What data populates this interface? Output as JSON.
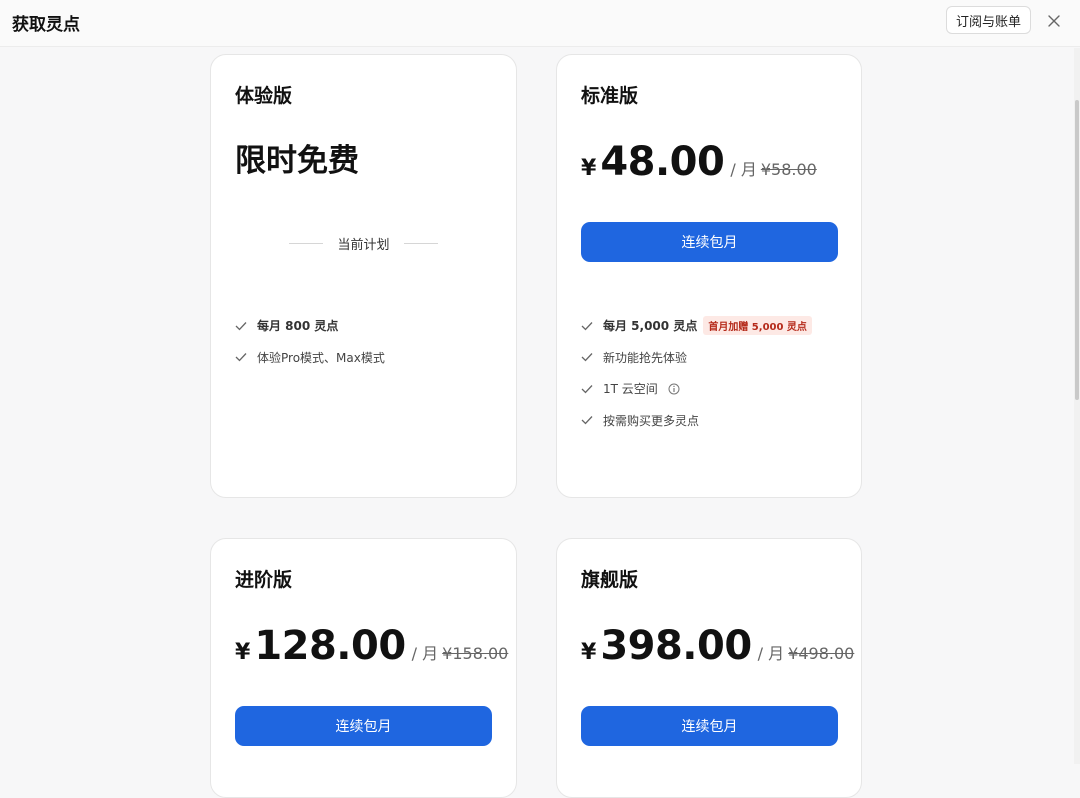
{
  "header": {
    "title": "获取灵点",
    "billing_label": "订阅与账单",
    "close_icon": "close-icon"
  },
  "plans": [
    {
      "name": "体验版",
      "price_text": "限时免费",
      "current_label": "当前计划",
      "features": [
        {
          "text": "每月 800 灵点",
          "bold": true
        },
        {
          "text": "体验Pro模式、Max模式"
        }
      ]
    },
    {
      "name": "标准版",
      "currency": "¥",
      "price": "48.00",
      "period": "/ 月",
      "original_price": "¥58.00",
      "button_label": "连续包月",
      "features": [
        {
          "text": "每月 5,000 灵点",
          "bold": true,
          "badge": "首月加赠 5,000 灵点"
        },
        {
          "text": "新功能抢先体验"
        },
        {
          "text": "1T 云空间",
          "icon": "info-icon"
        },
        {
          "text": "按需购买更多灵点"
        }
      ]
    },
    {
      "name": "进阶版",
      "currency": "¥",
      "price": "128.00",
      "period": "/ 月",
      "original_price": "¥158.00",
      "button_label": "连续包月"
    },
    {
      "name": "旗舰版",
      "currency": "¥",
      "price": "398.00",
      "period": "/ 月",
      "original_price": "¥498.00",
      "button_label": "连续包月"
    }
  ],
  "colors": {
    "accent": "#1f66e0",
    "promo_bg": "#fde9e5",
    "promo_text": "#b52a1a"
  }
}
